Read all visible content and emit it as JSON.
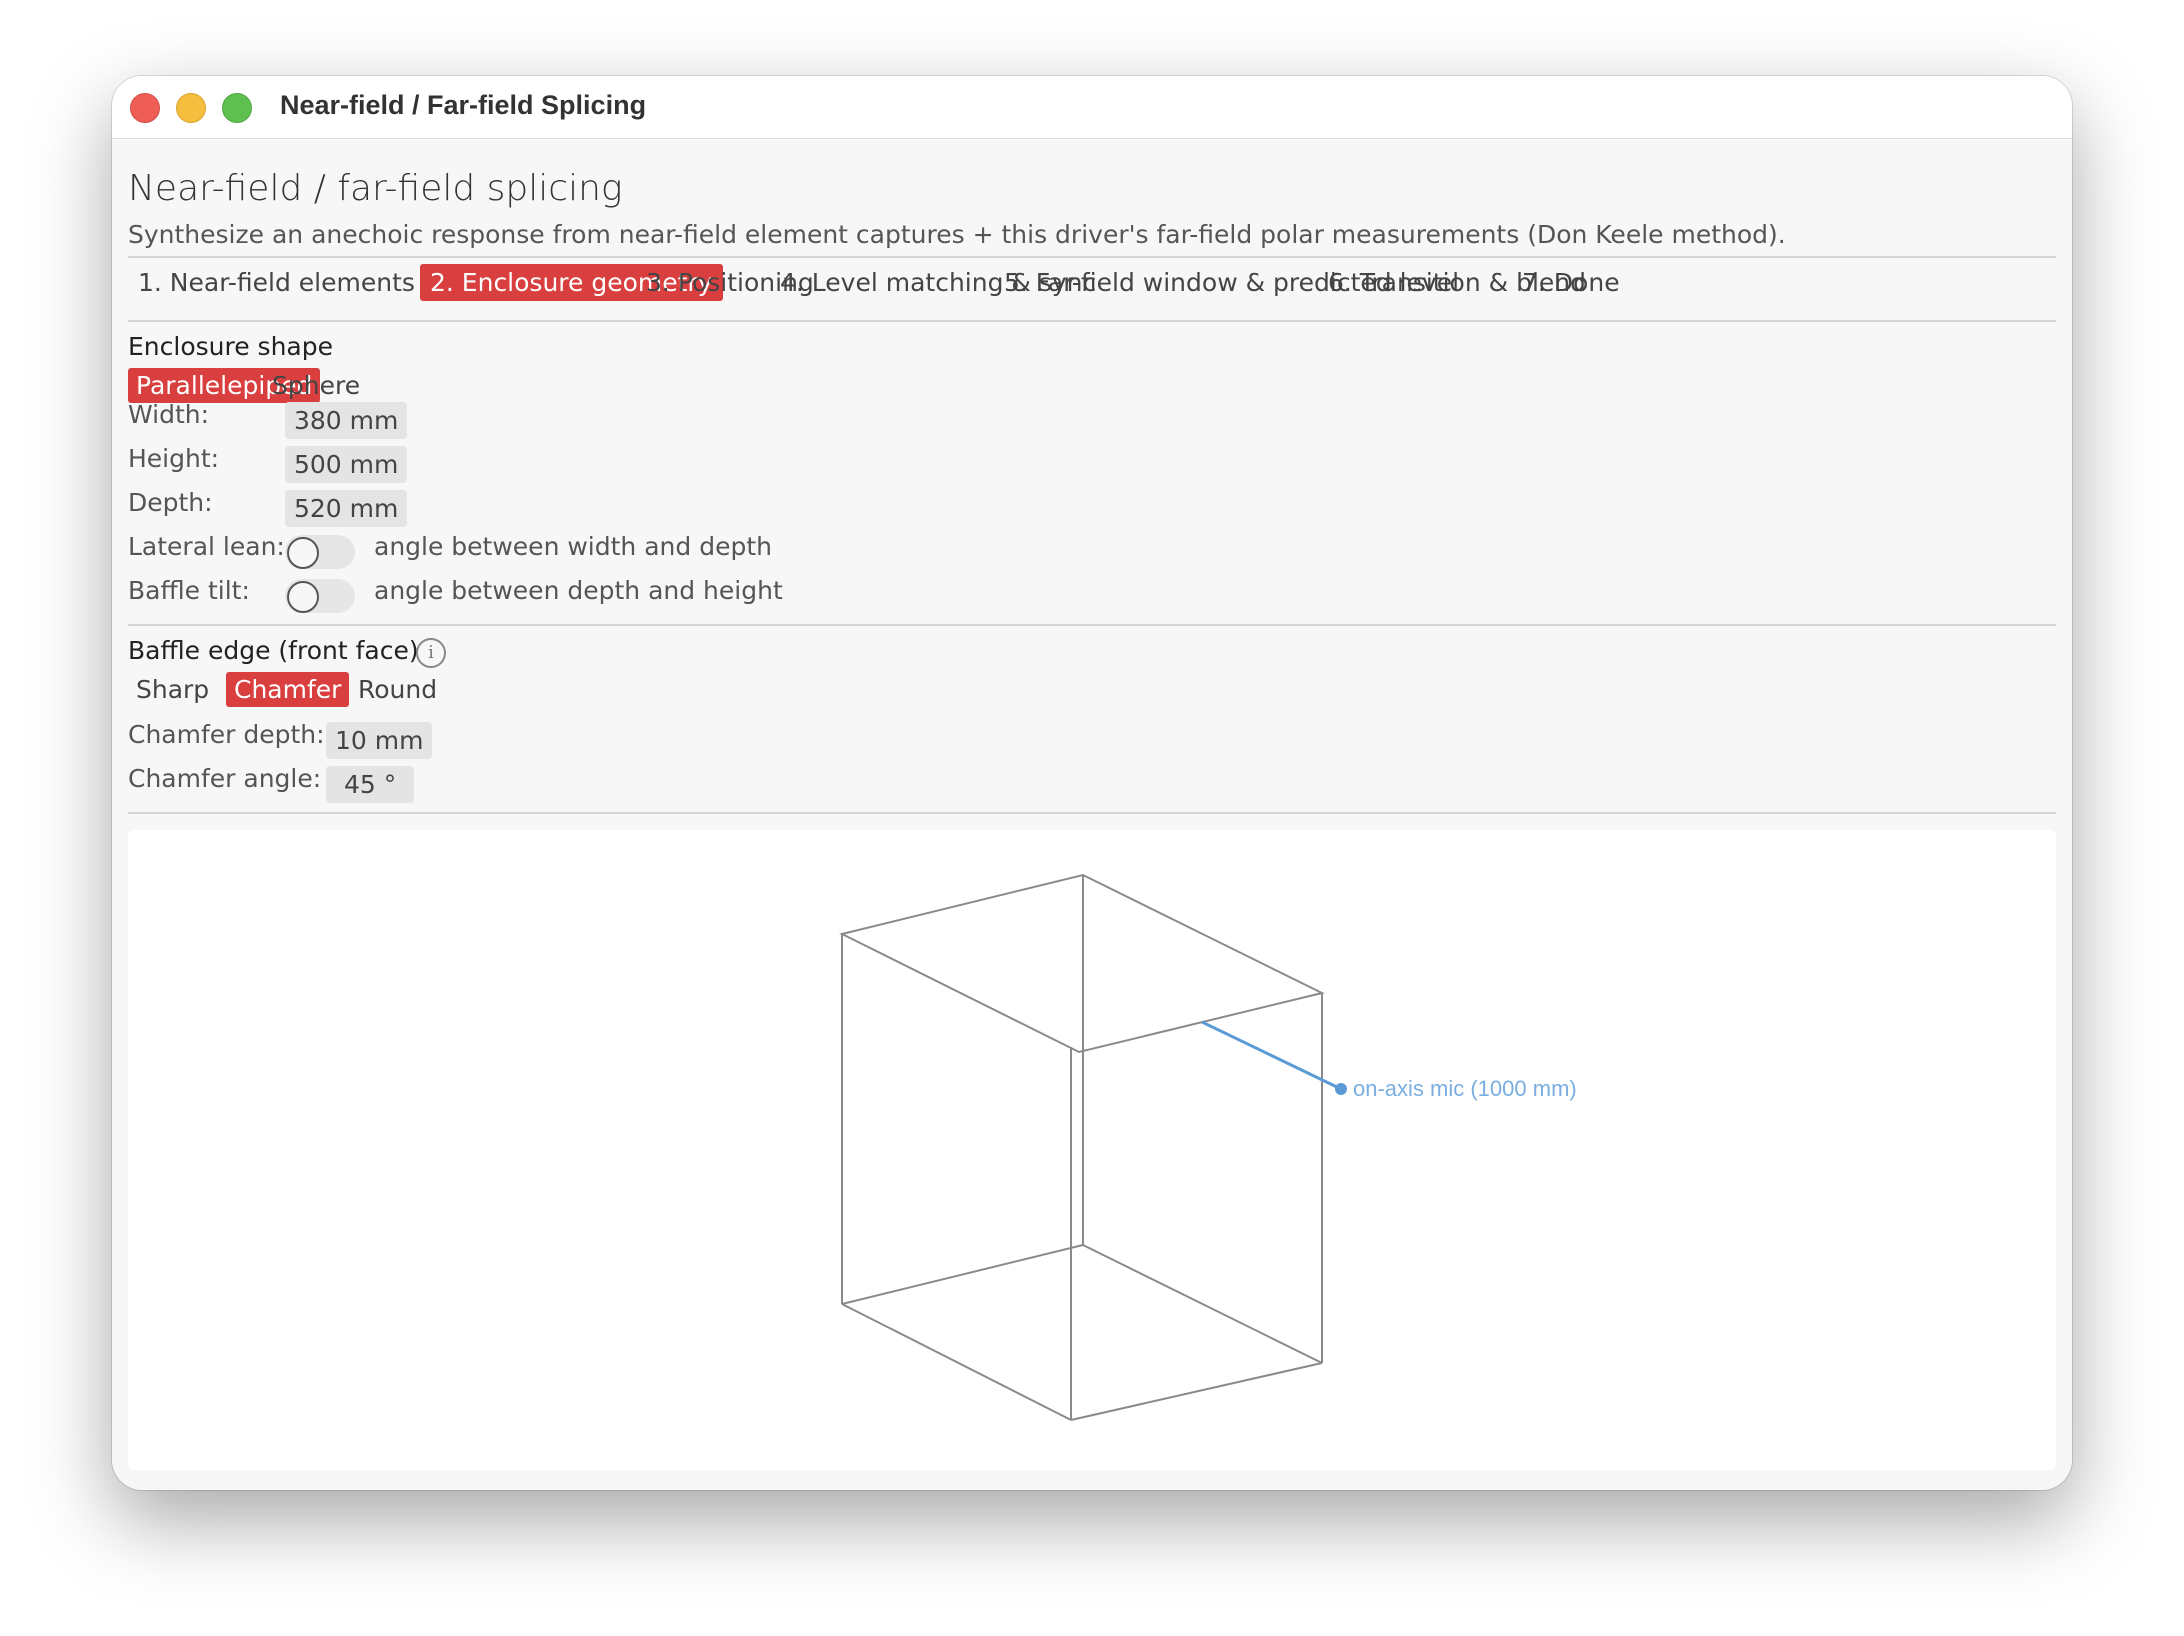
{
  "window": {
    "title": "Near-field / Far-field Splicing"
  },
  "header": {
    "heading": "Near-field / far-field splicing",
    "subtitle": "Synthesize an anechoic response from near-field element captures + this driver's far-field polar measurements (Don Keele method)."
  },
  "tabs": [
    {
      "label": "1. Near-field elements",
      "active": false
    },
    {
      "label": "2. Enclosure geometry",
      "active": true
    },
    {
      "label": "3. Positioning",
      "active": false
    },
    {
      "label": "4. Level matching & sync",
      "active": false
    },
    {
      "label": "5. Far-field window & predicted level",
      "active": false
    },
    {
      "label": "6. Transition & blend",
      "active": false
    },
    {
      "label": "7. Done",
      "active": false
    }
  ],
  "enclosure": {
    "section_label": "Enclosure shape",
    "shapes": [
      "Parallelepiped",
      "Sphere"
    ],
    "selected_shape": "Parallelepiped",
    "fields": [
      {
        "label": "Width:",
        "value": "380 mm"
      },
      {
        "label": "Height:",
        "value": "500 mm"
      },
      {
        "label": "Depth:",
        "value": "520 mm"
      }
    ],
    "toggles": [
      {
        "label": "Lateral lean:",
        "description": "angle between width and depth",
        "on": false
      },
      {
        "label": "Baffle tilt:",
        "description": "angle between depth and height",
        "on": false
      }
    ]
  },
  "baffle": {
    "section_label": "Baffle edge (front face)",
    "info_icon": "info-icon",
    "info_glyph": "i",
    "edge_types": [
      "Sharp",
      "Chamfer",
      "Round"
    ],
    "selected_edge": "Chamfer",
    "fields": [
      {
        "label": "Chamfer depth:",
        "value": "10 mm"
      },
      {
        "label": "Chamfer angle:",
        "value": "45 °"
      }
    ]
  },
  "preview": {
    "mic_label": "on-axis mic (1000 mm)",
    "mic_color": "#5b9bd5",
    "edge_color": "#8a8a8a"
  },
  "colors": {
    "accent": "#d93f3f"
  }
}
